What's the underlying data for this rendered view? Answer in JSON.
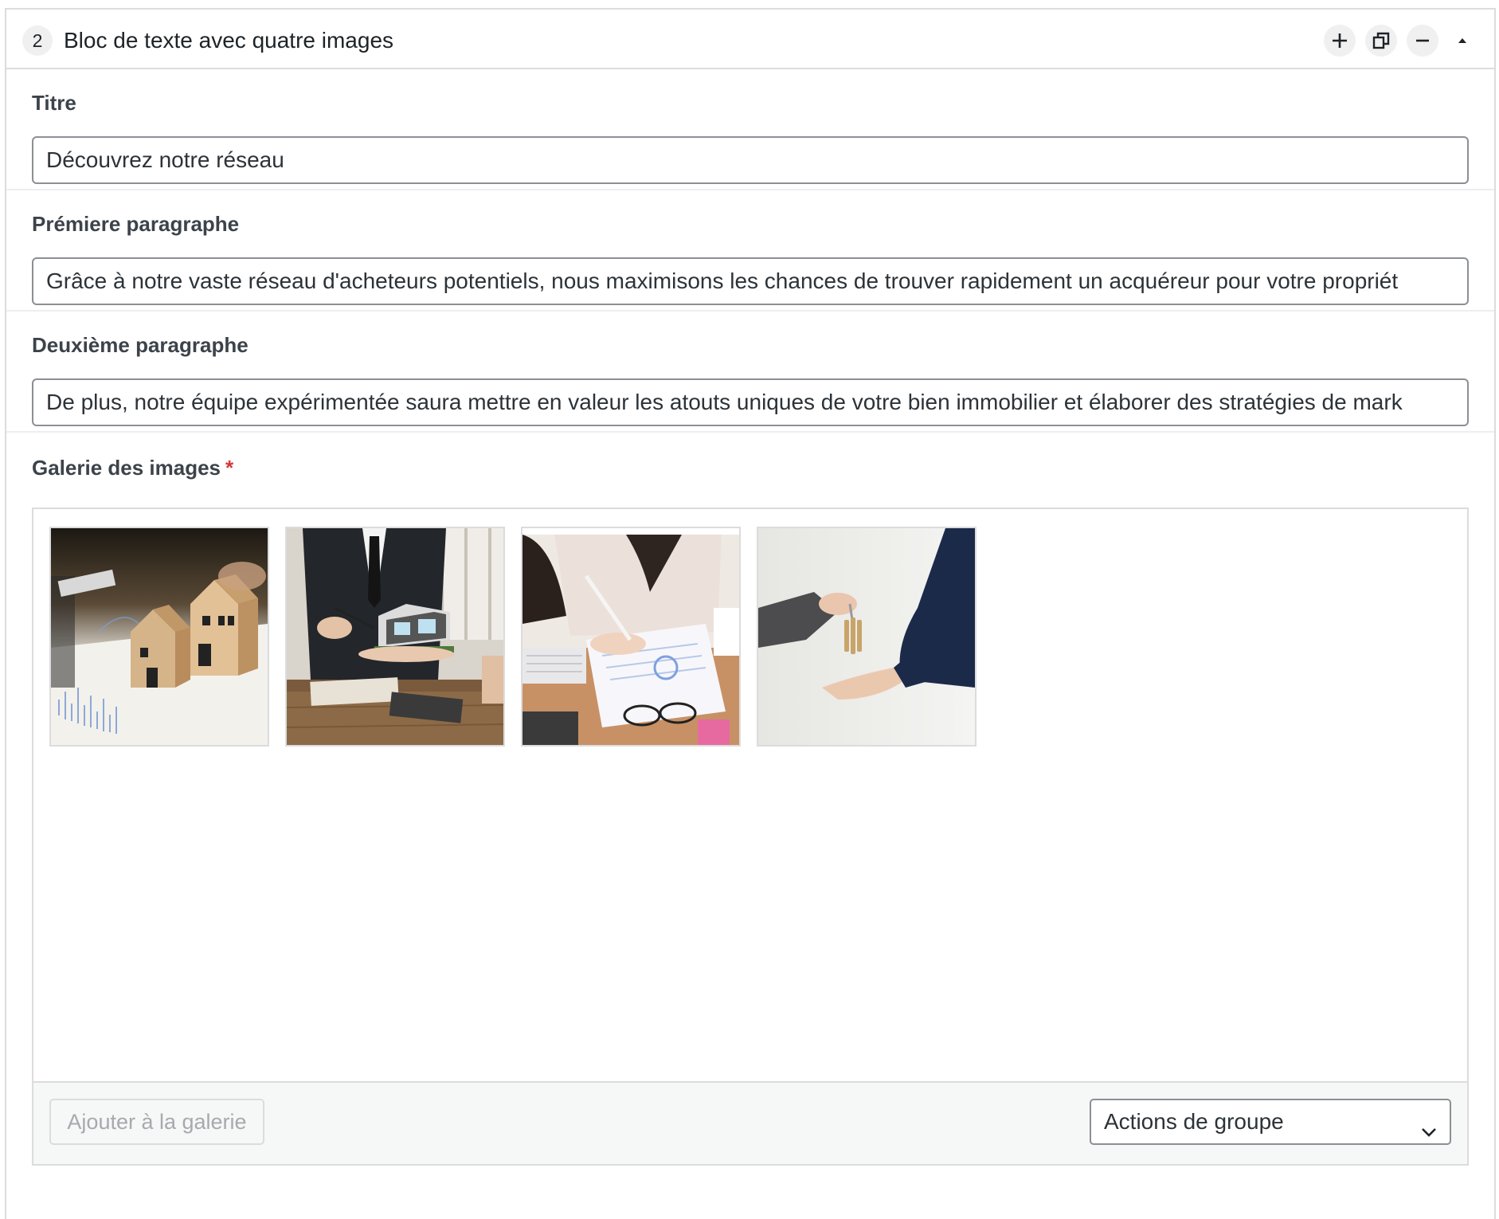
{
  "block": {
    "order": "2",
    "title": "Bloc de texte avec quatre images",
    "controls": [
      "plus-icon",
      "duplicate-icon",
      "minus-icon",
      "collapse-arrow-icon"
    ]
  },
  "fields": {
    "titre": {
      "label": "Titre",
      "value": "Découvrez notre réseau"
    },
    "premier_paragraphe": {
      "label": "Prémiere paragraphe",
      "value": "Grâce à notre vaste réseau d'acheteurs potentiels, nous maximisons les chances de trouver rapidement un acquéreur pour votre propriét"
    },
    "deuxieme_paragraphe": {
      "label": "Deuxième paragraphe",
      "value": "De plus, notre équipe expérimentée saura mettre en valeur les atouts uniques de votre bien immobilier et élaborer des stratégies de mark"
    },
    "galerie": {
      "label": "Galerie des images",
      "required_mark": "*",
      "images": [
        "wooden-houses-photo",
        "agent-house-model-photo",
        "woman-writing-documents-photo",
        "handing-keys-photo"
      ],
      "add_button": "Ajouter à la galerie",
      "bulk_actions": "Actions de groupe"
    }
  },
  "colors": {
    "border": "#dcdcde",
    "input_border": "#8c8f94",
    "required": "#d63638",
    "label": "#3c434a"
  }
}
